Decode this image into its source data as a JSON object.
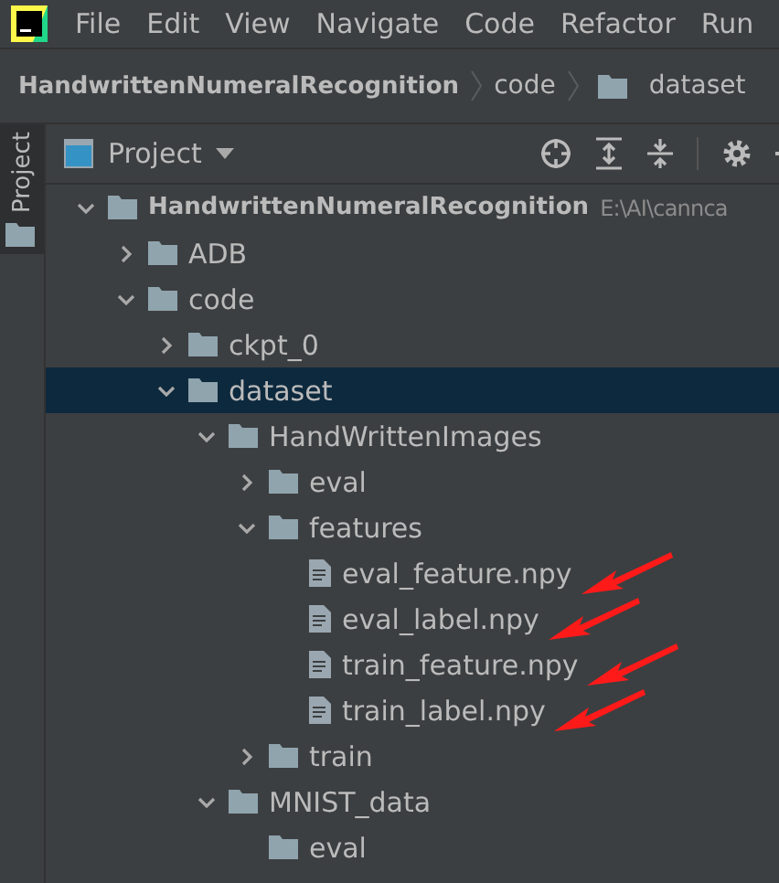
{
  "menu_bar": {
    "items": [
      "File",
      "Edit",
      "View",
      "Navigate",
      "Code",
      "Refactor",
      "Run"
    ]
  },
  "breadcrumb": [
    {
      "label": "HandwrittenNumeralRecognition",
      "kind": "project"
    },
    {
      "label": "code",
      "kind": "text"
    },
    {
      "label": "dataset",
      "kind": "folder"
    }
  ],
  "side_tabs": [
    {
      "label": "Project",
      "selected": true
    }
  ],
  "project_panel": {
    "title": "Project",
    "tree": [
      {
        "name": "HandwrittenNumeralRecognition",
        "path": "E:\\AI\\cannca",
        "kind": "folder",
        "expanded": true,
        "selected": false,
        "children": [
          {
            "name": "ADB",
            "kind": "folder",
            "expanded": false,
            "selected": false
          },
          {
            "name": "code",
            "kind": "folder",
            "expanded": true,
            "selected": false,
            "children": [
              {
                "name": "ckpt_0",
                "kind": "folder",
                "expanded": false,
                "selected": false
              },
              {
                "name": "dataset",
                "kind": "folder",
                "expanded": true,
                "selected": true,
                "children": [
                  {
                    "name": "HandWrittenImages",
                    "kind": "folder",
                    "expanded": true,
                    "selected": false,
                    "children": [
                      {
                        "name": "eval",
                        "kind": "folder",
                        "expanded": false,
                        "selected": false
                      },
                      {
                        "name": "features",
                        "kind": "folder",
                        "expanded": true,
                        "selected": false,
                        "children": [
                          {
                            "name": "eval_feature.npy",
                            "kind": "file",
                            "selected": false,
                            "pointed": true
                          },
                          {
                            "name": "eval_label.npy",
                            "kind": "file",
                            "selected": false,
                            "pointed": true
                          },
                          {
                            "name": "train_feature.npy",
                            "kind": "file",
                            "selected": false,
                            "pointed": true
                          },
                          {
                            "name": "train_label.npy",
                            "kind": "file",
                            "selected": false,
                            "pointed": true
                          }
                        ]
                      },
                      {
                        "name": "train",
                        "kind": "folder",
                        "expanded": false,
                        "selected": false
                      }
                    ]
                  },
                  {
                    "name": "MNIST_data",
                    "kind": "folder",
                    "expanded": true,
                    "selected": false,
                    "children": [
                      {
                        "name": "eval",
                        "kind": "folder",
                        "selected": false
                      }
                    ]
                  }
                ]
              }
            ]
          }
        ]
      }
    ]
  }
}
